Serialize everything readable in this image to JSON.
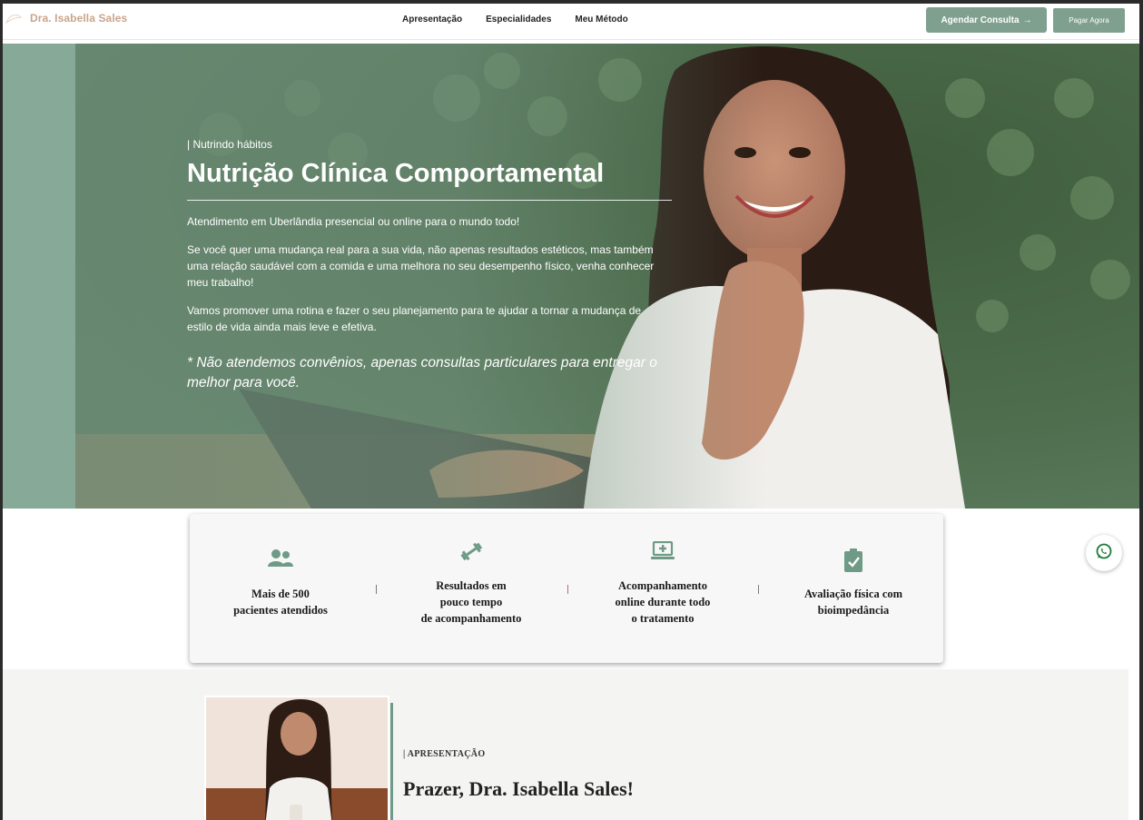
{
  "nav": {
    "brand": "Dra. Isabella Sales",
    "menu": [
      "Apresentação",
      "Especialidades",
      "Meu Método"
    ],
    "cta_primary": "Agendar Consulta",
    "cta_primary_arrow": "→",
    "cta_secondary": "Pagar Agora"
  },
  "hero": {
    "tag": "| Nutrindo hábitos",
    "title": "Nutrição Clínica Comportamental",
    "p1": "Atendimento em Uberlândia presencial ou online para o mundo todo!",
    "p2": "Se você quer uma mudança real para a sua vida, não apenas resultados estéticos, mas também uma relação saudável com a comida e uma melhora no seu desempenho físico, venha conhecer meu trabalho!",
    "p3": "Vamos promover uma rotina e fazer o seu planejamento para te ajudar a tornar a mudança de estilo de vida ainda mais leve e efetiva.",
    "note": "* Não atendemos convênios, apenas consultas particulares para entregar o melhor para você."
  },
  "features": [
    {
      "icon": "users-icon",
      "lines": [
        "Mais de 500",
        "pacientes atendidos"
      ]
    },
    {
      "icon": "dumbbell-icon",
      "lines": [
        "Resultados em",
        "pouco tempo",
        "de acompanhamento"
      ]
    },
    {
      "icon": "laptop-medical-icon",
      "lines": [
        "Acompanhamento",
        "online durante todo",
        "o tratamento"
      ]
    },
    {
      "icon": "clipboard-check-icon",
      "lines": [
        "Avaliação física com",
        "bioimpedância"
      ]
    }
  ],
  "about": {
    "tag": "| APRESENTAÇÃO",
    "title": "Prazer, Dra. Isabella Sales!"
  },
  "colors": {
    "accent": "#7fa08e",
    "brand": "#c9a48a",
    "hero_strip": "#86aa97"
  }
}
